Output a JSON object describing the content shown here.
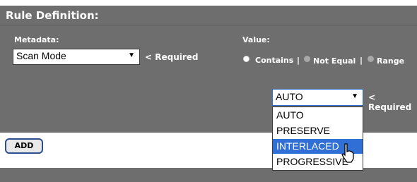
{
  "header": {
    "title": "Rule Definition:"
  },
  "metadata": {
    "label": "Metadata:",
    "selected": "Scan Mode",
    "required": "< Required"
  },
  "value": {
    "label": "Value:",
    "options": [
      {
        "label": "Contains",
        "selected": true
      },
      {
        "label": "Not Equal",
        "selected": false
      },
      {
        "label": "Range",
        "selected": false
      }
    ],
    "separator": "|"
  },
  "value_select": {
    "selected": "AUTO",
    "required": "< Required",
    "options": [
      "AUTO",
      "PRESERVE",
      "INTERLACED",
      "PROGRESSIVE"
    ],
    "highlighted_index": 2
  },
  "add_button": {
    "label": "ADD"
  },
  "icons": {
    "dropdown_arrow": "▼",
    "cursor": "mouse-pointer"
  }
}
